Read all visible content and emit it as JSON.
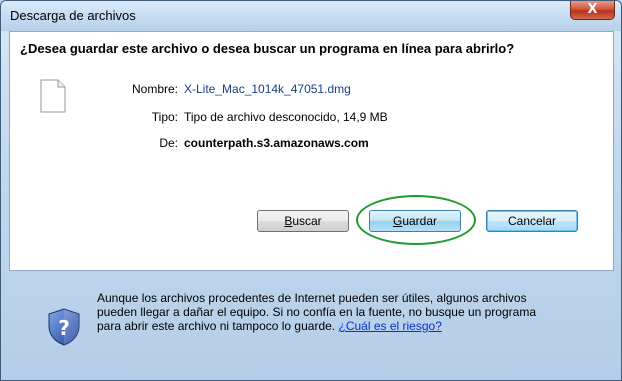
{
  "window": {
    "title": "Descarga de archivos",
    "close_label": "X"
  },
  "question": "¿Desea guardar este archivo o desea buscar un programa en línea para abrirlo?",
  "file": {
    "icon": "blank-document-icon",
    "name_label": "Nombre:",
    "name_value": "X-Lite_Mac_1014k_47051.dmg",
    "type_label": "Tipo:",
    "type_value": "Tipo de archivo desconocido, 14,9 MB",
    "from_label": "De:",
    "from_value": "counterpath.s3.amazonaws.com"
  },
  "buttons": {
    "search_label": "Buscar",
    "search_accel": "B",
    "search_rest": "uscar",
    "save_label": "Guardar",
    "save_accel": "G",
    "save_rest": "uardar",
    "cancel_label": "Cancelar"
  },
  "warning": {
    "icon": "shield-question-icon",
    "text": "Aunque los archivos procedentes de Internet pueden ser útiles, algunos archivos pueden llegar a dañar el equipo. Si no confía en la fuente, no busque un programa para abrir este archivo ni tampoco lo guarde.",
    "link_text": "¿Cuál es el riesgo?"
  },
  "colors": {
    "highlight": "#1f9b2b",
    "link": "#0033cc",
    "filename": "#1a3d86"
  }
}
